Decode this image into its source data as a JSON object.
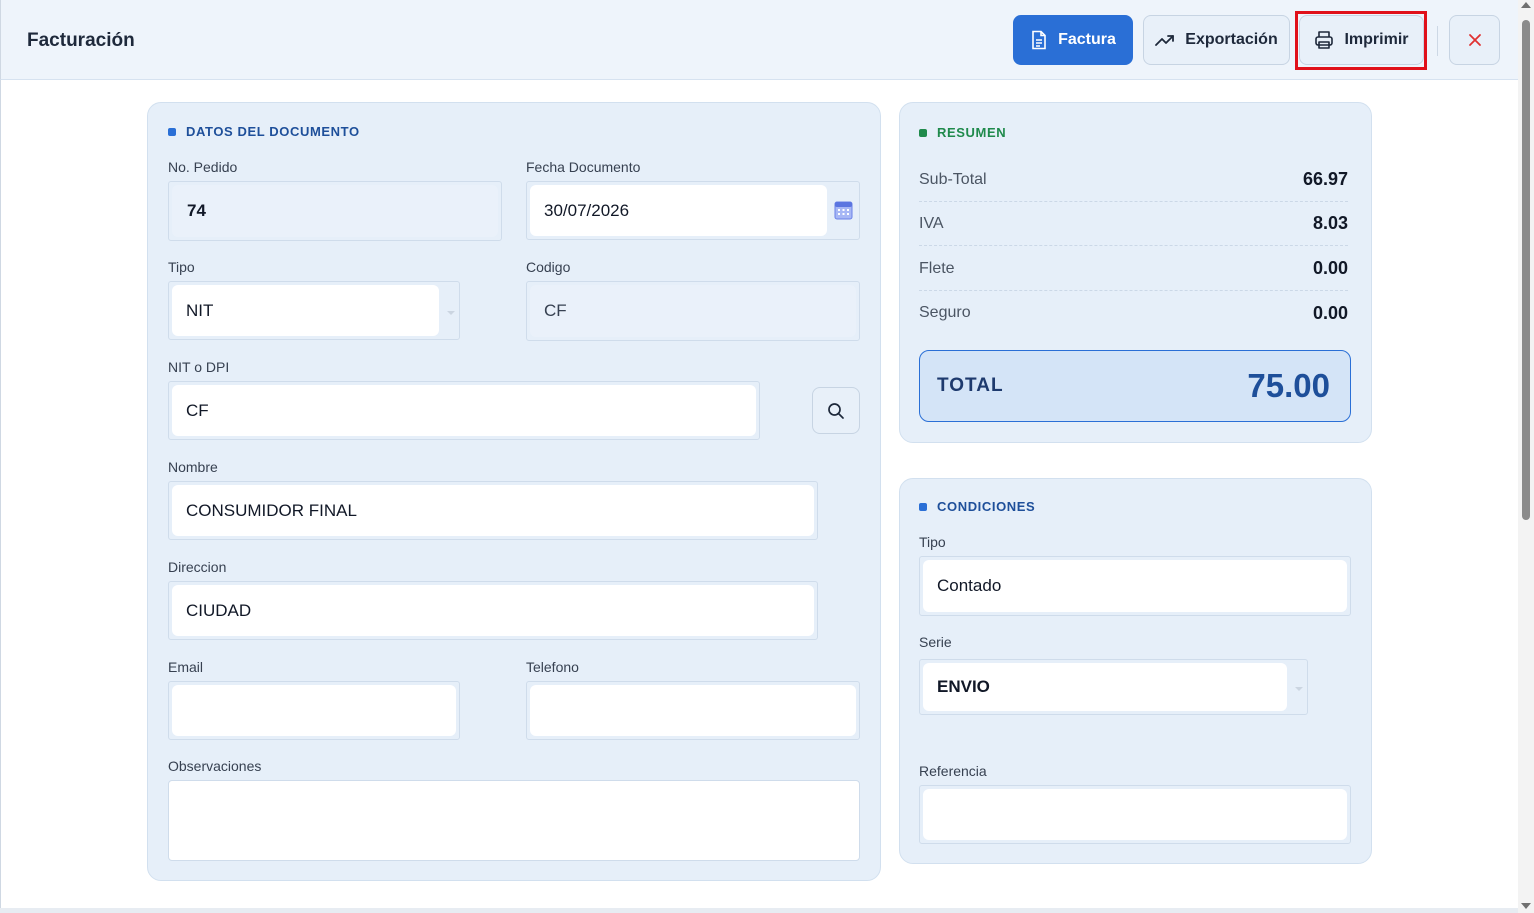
{
  "header": {
    "title": "Facturación",
    "buttons": {
      "factura": "Factura",
      "exportacion": "Exportación",
      "imprimir": "Imprimir"
    }
  },
  "documento": {
    "section_title": "DATOS DEL DOCUMENTO",
    "no_pedido": {
      "label": "No. Pedido",
      "value": "74"
    },
    "fecha": {
      "label": "Fecha Documento",
      "value": "30/07/2026"
    },
    "tipo": {
      "label": "Tipo",
      "value": "NIT"
    },
    "codigo": {
      "label": "Codigo",
      "value": "CF"
    },
    "nit": {
      "label": "NIT o DPI",
      "value": "CF"
    },
    "nombre": {
      "label": "Nombre",
      "value": "CONSUMIDOR FINAL"
    },
    "direccion": {
      "label": "Direccion",
      "value": "CIUDAD"
    },
    "email": {
      "label": "Email",
      "value": ""
    },
    "telefono": {
      "label": "Telefono",
      "value": ""
    },
    "observaciones": {
      "label": "Observaciones",
      "value": ""
    }
  },
  "resumen": {
    "section_title": "RESUMEN",
    "rows": [
      {
        "label": "Sub-Total",
        "value": "66.97"
      },
      {
        "label": "IVA",
        "value": "8.03"
      },
      {
        "label": "Flete",
        "value": "0.00"
      },
      {
        "label": "Seguro",
        "value": "0.00"
      }
    ],
    "total_label": "TOTAL",
    "total_value": "75.00"
  },
  "condiciones": {
    "section_title": "CONDICIONES",
    "tipo": {
      "label": "Tipo",
      "value": "Contado"
    },
    "serie": {
      "label": "Serie",
      "value": "ENVIO"
    },
    "referencia": {
      "label": "Referencia",
      "value": ""
    }
  },
  "colors": {
    "primary": "#2a6fd6",
    "highlight": "#e0101a",
    "close": "#e03131",
    "success": "#1f8a4c"
  }
}
